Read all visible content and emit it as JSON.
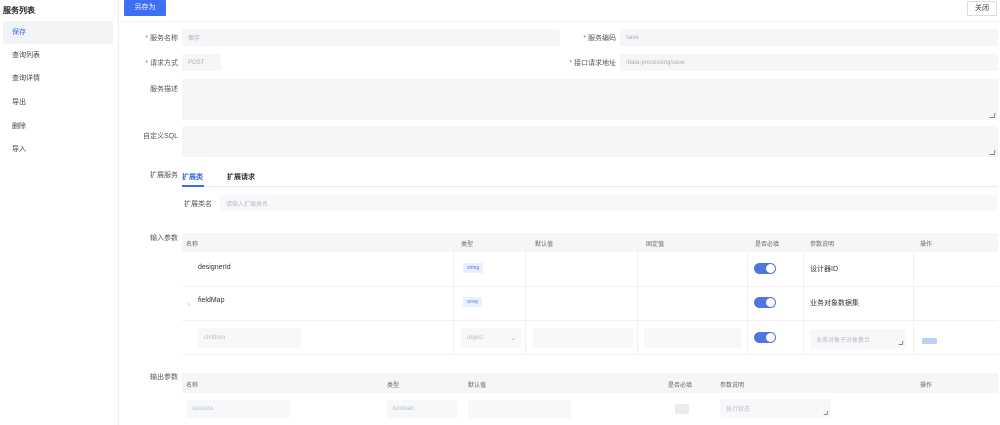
{
  "sidebar": {
    "title": "服务列表",
    "items": [
      {
        "label": "保存",
        "active": true
      },
      {
        "label": "查询列表",
        "active": false
      },
      {
        "label": "查询详情",
        "active": false
      },
      {
        "label": "导出",
        "active": false
      },
      {
        "label": "删除",
        "active": false
      },
      {
        "label": "导入",
        "active": false
      }
    ]
  },
  "toolbar": {
    "save_as_label": "另存为",
    "close_label": "关闭"
  },
  "form": {
    "service_name": {
      "label": "服务名称",
      "value": "保存"
    },
    "service_code": {
      "label": "服务编码",
      "value": "save"
    },
    "request_method": {
      "label": "请求方式",
      "value": "POST"
    },
    "api_path": {
      "label": "接口请求地址",
      "value": "/data-processing/save"
    },
    "service_desc": {
      "label": "服务描述",
      "value": ""
    },
    "custom_sql": {
      "label": "自定义SQL",
      "value": ""
    },
    "extension": {
      "label": "扩展服务",
      "tabs": [
        {
          "label": "扩展类",
          "active": true
        },
        {
          "label": "扩展请求",
          "active": false
        }
      ],
      "class_name_label": "扩展类名",
      "class_name_placeholder": "请输入扩展类名"
    }
  },
  "input_params": {
    "label": "输入参数",
    "columns": [
      "名称",
      "类型",
      "默认值",
      "固定值",
      "是否必填",
      "参数说明",
      "操作"
    ],
    "rows": [
      {
        "name": "designerId",
        "type": "string",
        "required": true,
        "desc": "设计器ID"
      },
      {
        "name": "fieldMap",
        "type": "array",
        "required": true,
        "desc": "业务对象数据集"
      },
      {
        "name": "children",
        "type": "object",
        "required": true,
        "desc": "业务对象子对象集合"
      }
    ]
  },
  "output_params": {
    "label": "输出参数",
    "columns": [
      "名称",
      "类型",
      "默认值",
      "是否必填",
      "参数说明",
      "操作"
    ],
    "rows": [
      {
        "name": "success",
        "type": "boolean",
        "required": false,
        "desc": "执行状态"
      }
    ]
  },
  "colors": {
    "accent": "#3e6ff2",
    "required_star": "#e34d4d",
    "toggle_on": "#4f75e3"
  }
}
